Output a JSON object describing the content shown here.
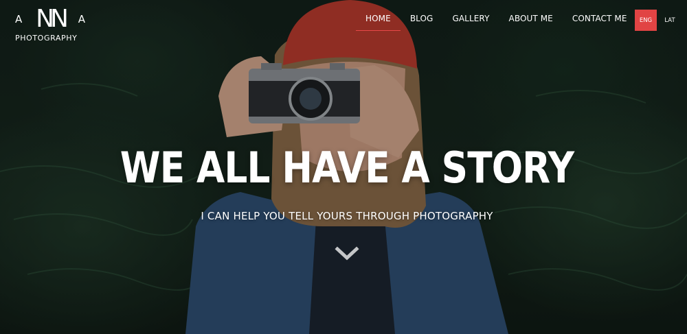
{
  "logo": {
    "left_letter": "A",
    "mark": "NN",
    "right_letter": "A",
    "subtitle": "PHOTOGRAPHY"
  },
  "nav": [
    {
      "label": "HOME",
      "active": true
    },
    {
      "label": "BLOG",
      "active": false
    },
    {
      "label": "GALLERY",
      "active": false
    },
    {
      "label": "ABOUT ME",
      "active": false
    },
    {
      "label": "CONTACT ME",
      "active": false
    }
  ],
  "language": {
    "current": "ENG",
    "alternate": "LAT"
  },
  "hero": {
    "headline": "WE ALL HAVE A STORY",
    "subheadline": "I CAN HELP YOU TELL YOURS THROUGH PHOTOGRAPHY",
    "scroll_icon": "chevron-down-icon"
  },
  "colors": {
    "accent": "#e14444",
    "text": "#ffffff",
    "background": "#13201a"
  }
}
